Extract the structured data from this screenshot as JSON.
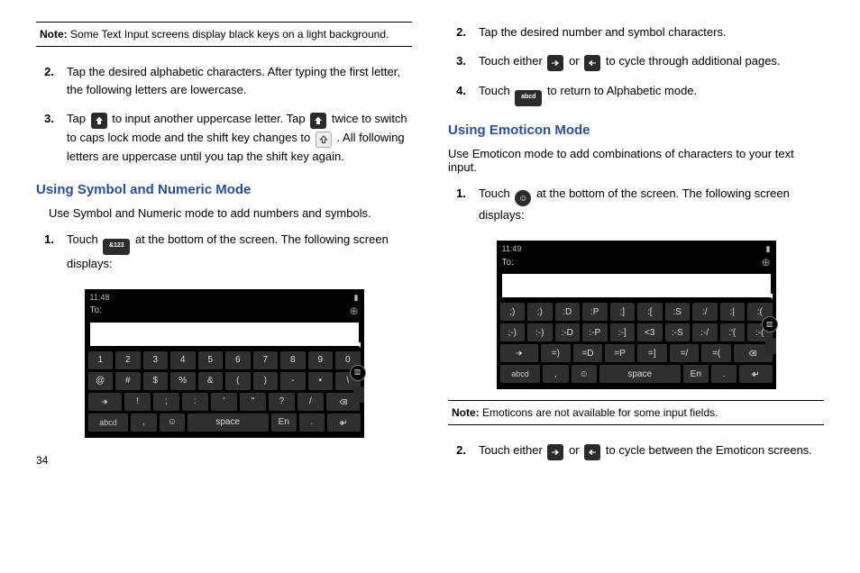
{
  "pageNumber": "34",
  "notes": {
    "label": "Note:",
    "top": "Some Text Input screens display black keys on a light background.",
    "bottom": "Emoticons are not available for some input fields."
  },
  "left": {
    "step2": "Tap the desired alphabetic characters. After typing the first letter, the following letters are lowercase.",
    "step3a": "Tap ",
    "step3b": " to input another uppercase letter. Tap ",
    "step3c": " twice to switch to caps lock mode and the shift key changes to ",
    "step3d": ". All following letters are uppercase until you tap the shift key again.",
    "heading": "Using Symbol and Numeric Mode",
    "intro": "Use Symbol and Numeric mode to add numbers and symbols.",
    "step1a": "Touch ",
    "step1b": " at the bottom of the screen. The following screen displays:"
  },
  "right": {
    "step2": "Tap the desired number and symbol characters.",
    "step3a": "Touch either ",
    "step3b": " or ",
    "step3c": " to cycle through additional pages.",
    "step4a": "Touch ",
    "step4b": " to return to Alphabetic mode.",
    "heading": "Using Emoticon Mode",
    "intro": "Use Emoticon mode to add combinations of characters to your text input.",
    "step1a": "Touch ",
    "step1b": " at the bottom of the screen. The following screen displays:",
    "stepB2a": "Touch either ",
    "stepB2b": " or ",
    "stepB2c": " to cycle between the Emoticon screens."
  },
  "iconLabels": {
    "and123": "&123",
    "abcd": "abcd"
  },
  "screenshotSym": {
    "time": "11:48",
    "toLabel": "To:",
    "rows": [
      [
        "1",
        "2",
        "3",
        "4",
        "5",
        "6",
        "7",
        "8",
        "9",
        "0"
      ],
      [
        "@",
        "#",
        "$",
        "%",
        "&",
        "(",
        ")",
        "-",
        "•",
        "\\"
      ],
      [
        "→",
        "!",
        ";",
        ":",
        "'",
        "\"",
        "?",
        "/",
        "⌫"
      ],
      [
        "abcd",
        ",",
        "☺",
        "space",
        "En",
        ".",
        "↵"
      ]
    ]
  },
  "screenshotEmo": {
    "time": "11:49",
    "toLabel": "To:",
    "rows": [
      [
        ";)",
        ":)",
        ":D",
        ":P",
        ":]",
        ":[",
        ":S",
        ":/",
        ":|",
        ":("
      ],
      [
        ";-)",
        ":-)",
        ":-D",
        ":-P",
        ":-]",
        "<3",
        ":-S",
        ":-/",
        ":'(",
        ":-("
      ],
      [
        "→",
        "=)",
        "=D",
        "=P",
        "=]",
        "=/",
        "=(",
        "⌫"
      ],
      [
        "abcd",
        ",",
        "☺",
        "space",
        "En",
        ".",
        "↵"
      ]
    ]
  }
}
